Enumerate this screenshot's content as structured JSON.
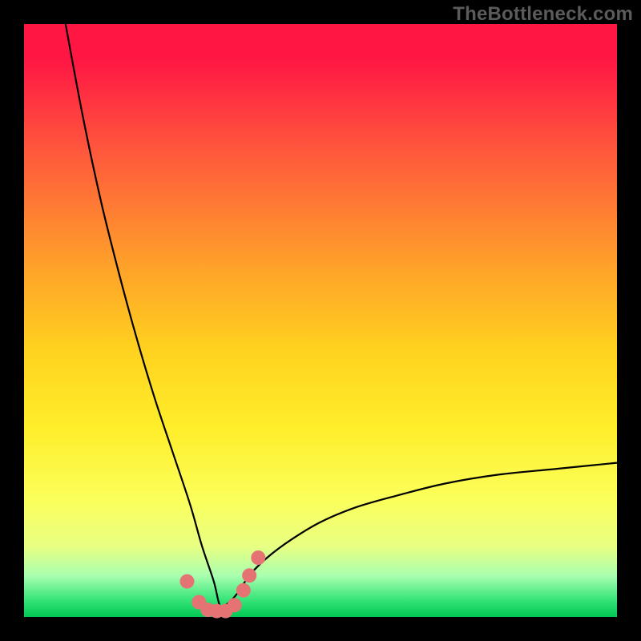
{
  "watermark": "TheBottleneck.com",
  "colors": {
    "frame": "#000000",
    "curve": "#000000",
    "marker": "#e57373",
    "gradient_css": "background: linear-gradient(to bottom, #ff1744 0%, #ff1744 6%, #ff5a3c 22%, #ff9e2a 40%, #ffd21f 55%, #ffee2a 68%, #fbff5a 80%, #e9ff82 88%, #aaffaf 93%, #39e57a 97%, #00c853 100%);"
  },
  "chart_data": {
    "type": "line",
    "title": "",
    "xlabel": "",
    "ylabel": "",
    "xlim": [
      0,
      100
    ],
    "ylim": [
      0,
      100
    ],
    "note": "Axes are unlabeled in the source image; values below are normalized 0-100 estimates read from pixel position relative to the colored plot region. The curve is a V / bottleneck shape reaching ~0 around x≈33 and rising to ~26 at x=100 on the right and ~100 at x≈7 on the left.",
    "series": [
      {
        "name": "bottleneck-curve",
        "x": [
          7,
          10,
          13,
          16,
          19,
          22,
          25,
          28,
          30,
          32,
          33,
          34,
          36,
          38,
          41,
          45,
          50,
          56,
          63,
          71,
          80,
          90,
          100
        ],
        "y": [
          100,
          84,
          70,
          58,
          47,
          37,
          28,
          19,
          12,
          6,
          2,
          2,
          4,
          7,
          10,
          13,
          16,
          18.5,
          20.5,
          22.5,
          24,
          25,
          26
        ]
      }
    ],
    "markers": {
      "name": "highlighted-points",
      "x": [
        27.5,
        29.5,
        31,
        32.5,
        34,
        35.5,
        37,
        38,
        39.5
      ],
      "y": [
        6,
        2.5,
        1.2,
        1,
        1,
        2,
        4.5,
        7,
        10
      ]
    }
  }
}
